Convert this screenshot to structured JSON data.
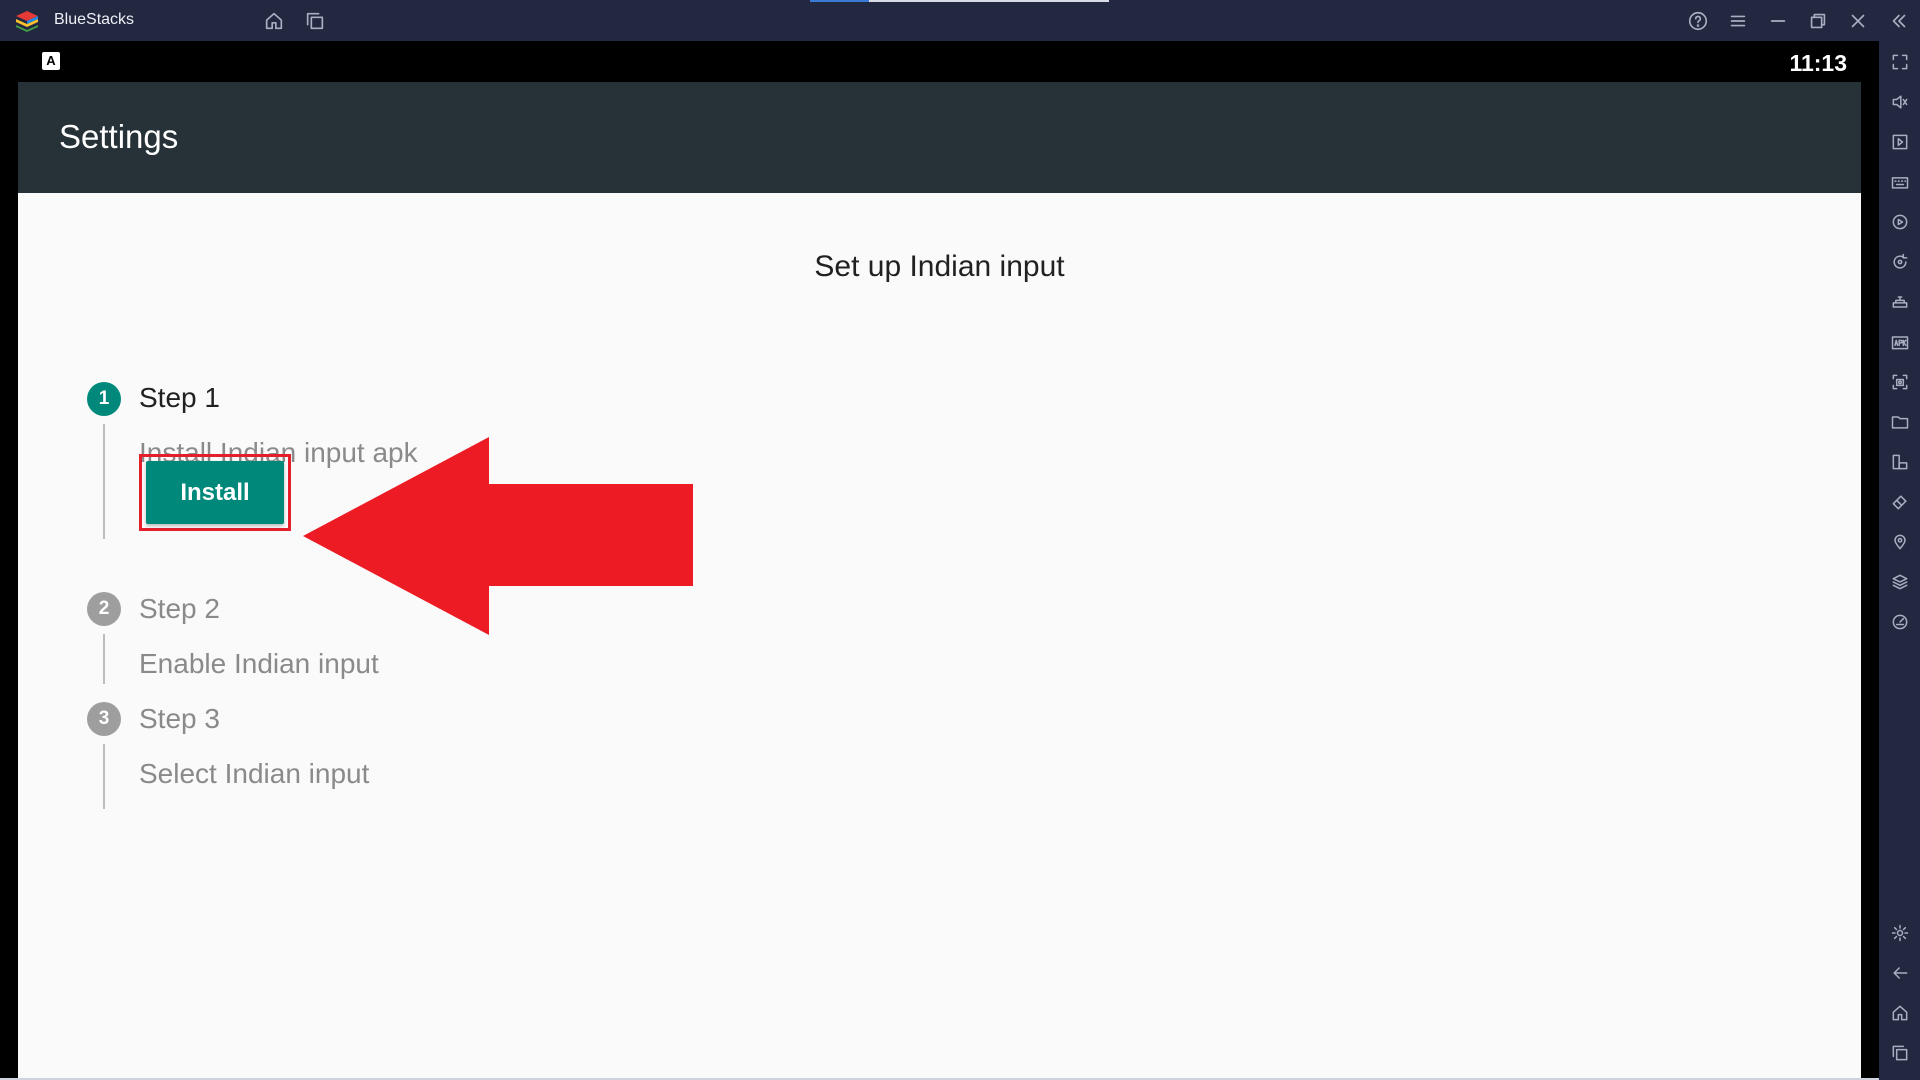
{
  "window": {
    "app_name": "BlueStacks"
  },
  "android_status": {
    "keyboard_indicator": "A",
    "time": "11:13"
  },
  "appbar": {
    "title": "Settings"
  },
  "page": {
    "heading": "Set up Indian input",
    "steps": [
      {
        "number": "1",
        "title": "Step 1",
        "description": "Install Indian input apk",
        "state": "active",
        "button_label": "Install"
      },
      {
        "number": "2",
        "title": "Step 2",
        "description": "Enable Indian input",
        "state": "inactive"
      },
      {
        "number": "3",
        "title": "Step 3",
        "description": "Select Indian input",
        "state": "inactive"
      }
    ]
  },
  "annotation": {
    "arrow_color": "#ed1c24",
    "highlight_color": "#e41f2b"
  },
  "colors": {
    "accent": "#00897b",
    "appbar": "#263238",
    "chrome": "#212840"
  },
  "title_bar_icons": [
    "bluestacks-logo-icon",
    "home-icon",
    "multi-instance-icon",
    "help-icon",
    "menu-icon",
    "minimize-icon",
    "restore-icon",
    "close-icon",
    "collapse-sidebar-icon"
  ],
  "sidebar_icons": [
    "fullscreen-icon",
    "volume-icon",
    "media-manager-icon",
    "keyboard-icon",
    "macro-icon",
    "sync-icon",
    "game-controls-icon",
    "apk-install-icon",
    "screenshot-icon",
    "folder-icon",
    "multi-instance-icon",
    "erase-icon",
    "location-icon",
    "layers-icon",
    "eco-mode-icon",
    "settings-icon",
    "back-icon",
    "home-icon",
    "recent-apps-icon"
  ]
}
